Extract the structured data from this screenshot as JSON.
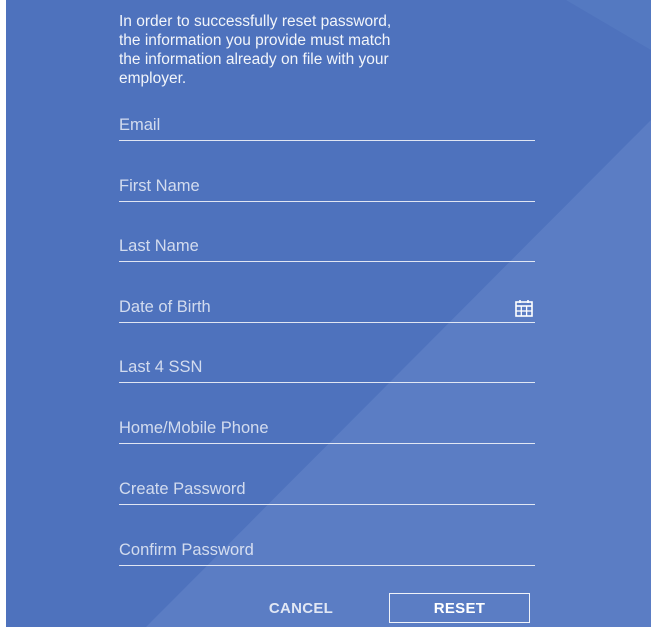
{
  "intro": {
    "line1": "In order to successfully reset password,",
    "line2": "the information you provide must match",
    "line3": "the information already on file with your",
    "line4": "employer."
  },
  "fields": {
    "email": "Email",
    "first_name": "First Name",
    "last_name": "Last Name",
    "dob": "Date of Birth",
    "ssn": "Last 4 SSN",
    "phone": "Home/Mobile Phone",
    "create_password": "Create Password",
    "confirm_password": "Confirm Password"
  },
  "icons": {
    "dob": "calendar-icon"
  },
  "buttons": {
    "cancel": "CANCEL",
    "reset": "RESET"
  },
  "colors": {
    "background": "#4e72bd",
    "text": "#ffffff"
  }
}
